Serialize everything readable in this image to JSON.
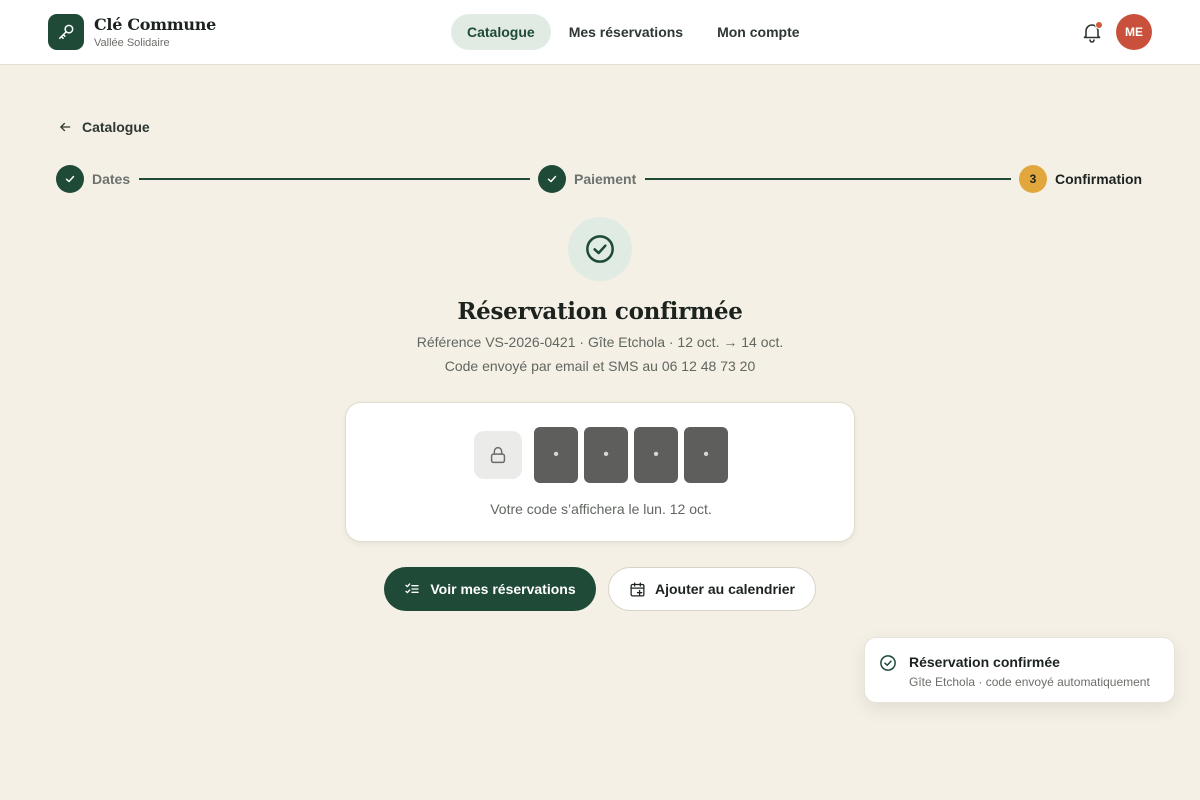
{
  "brand": {
    "name": "Clé Commune",
    "subtitle": "Vallée Solidaire"
  },
  "nav": {
    "items": [
      {
        "label": "Catalogue",
        "active": true
      },
      {
        "label": "Mes réservations",
        "active": false
      },
      {
        "label": "Mon compte",
        "active": false
      }
    ]
  },
  "header": {
    "avatar_initials": "ME",
    "has_notification": true
  },
  "back_link": {
    "label": "Catalogue"
  },
  "stepper": {
    "steps": [
      {
        "label": "Dates",
        "state": "done"
      },
      {
        "label": "Paiement",
        "state": "done"
      },
      {
        "label": "Confirmation",
        "state": "current",
        "number": "3"
      }
    ]
  },
  "confirmation": {
    "title": "Réservation confirmée",
    "details": "Référence VS-2026-0421 · Gîte Etchola · 12 oct. → 14 oct.",
    "delivery": "Code envoyé par email et SMS au 06 12 48 73 20"
  },
  "code_card": {
    "digits": [
      "•",
      "•",
      "•",
      "•"
    ],
    "note": "Votre code s’affichera le lun. 12 oct."
  },
  "actions": {
    "primary_label": "Voir mes réservations",
    "secondary_label": "Ajouter au calendrier"
  },
  "toast": {
    "title": "Réservation confirmée",
    "subtitle": "Gîte Etchola · code envoyé automatiquement"
  },
  "colors": {
    "primary": "#1f4a38",
    "accent": "#e2a73c",
    "avatar": "#c9503a",
    "background": "#f4f0e6"
  },
  "icons": {
    "logo": "key-icon",
    "notifications": "bell-icon",
    "back": "arrow-left-icon",
    "step_done": "check-icon",
    "success": "check-circle-icon",
    "code": "lock-icon",
    "primary_action": "list-check-icon",
    "secondary_action": "calendar-plus-icon"
  }
}
